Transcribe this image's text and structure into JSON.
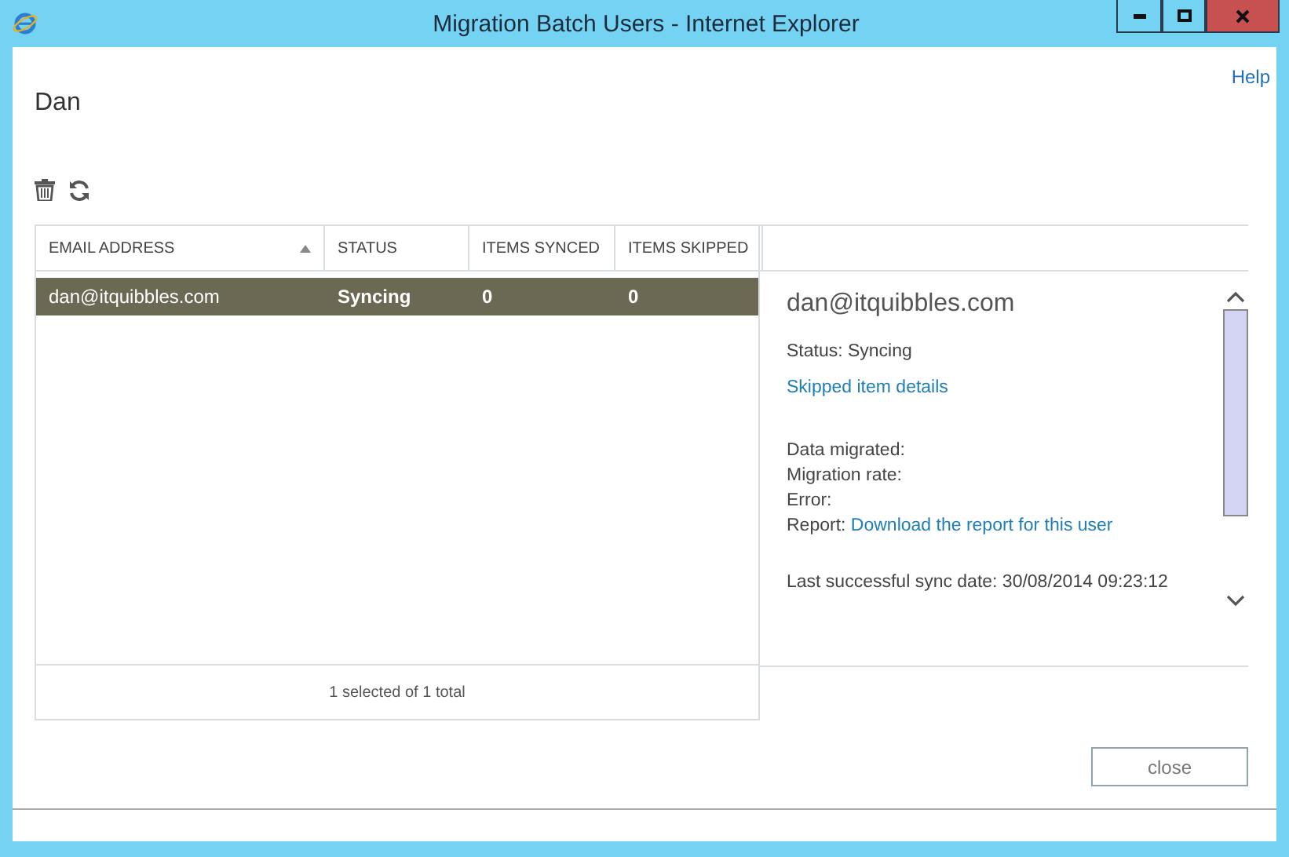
{
  "window": {
    "title": "Migration Batch Users - Internet Explorer"
  },
  "help_link": "Help",
  "heading": "Dan",
  "table": {
    "columns": [
      {
        "label": "EMAIL ADDRESS",
        "sorted": true
      },
      {
        "label": "STATUS",
        "sorted": false
      },
      {
        "label": "ITEMS SYNCED",
        "sorted": false
      },
      {
        "label": "ITEMS SKIPPED",
        "sorted": false
      }
    ],
    "rows": [
      {
        "cells": [
          "dan@itquibbles.com",
          "Syncing",
          "0",
          "0"
        ],
        "selected": true
      }
    ],
    "footer": "1 selected of 1 total"
  },
  "details": {
    "title": "dan@itquibbles.com",
    "status": "Status: Syncing",
    "skipped_link": "Skipped item details",
    "fields": [
      {
        "label": "Data migrated:"
      },
      {
        "label": "Migration rate:"
      },
      {
        "label": "Error:"
      },
      {
        "label": "Report:",
        "link": "Download the report for this user"
      }
    ],
    "last_sync": "Last successful sync date: 30/08/2014 09:23:12"
  },
  "close_button": "close"
}
